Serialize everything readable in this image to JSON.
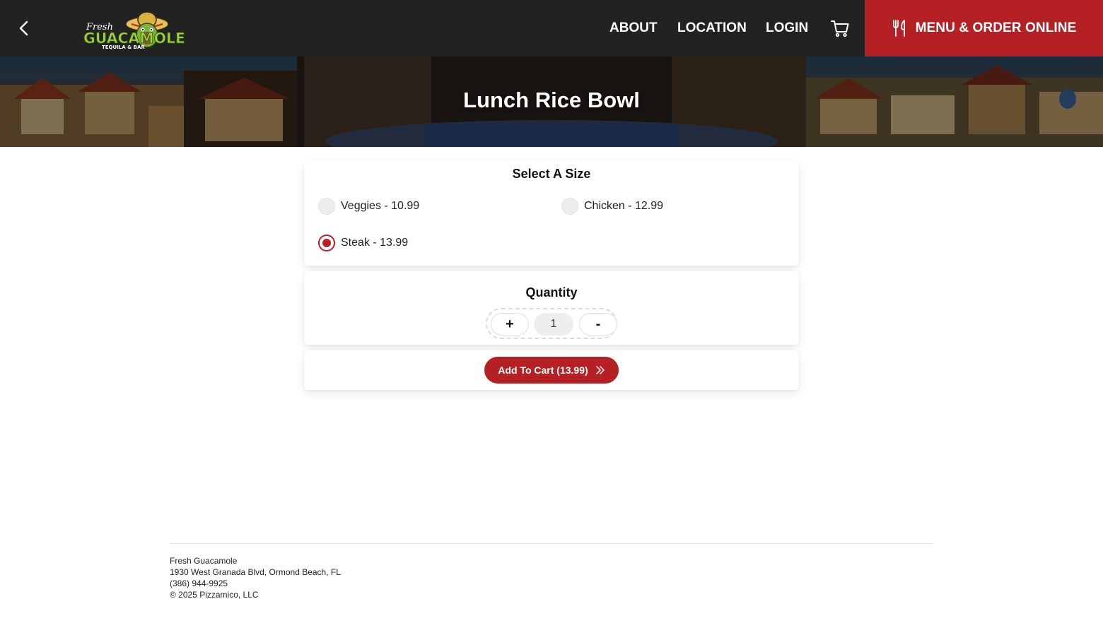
{
  "header": {
    "back_icon": "chevron-left-icon",
    "logo": {
      "line1": "Fresh",
      "line2": "GUACAMOLE",
      "line3": "TEQUILA & BAR"
    },
    "nav": [
      "ABOUT",
      "LOCATION",
      "LOGIN"
    ],
    "cart_icon": "cart-icon",
    "order_button": {
      "icon": "fork-knife-icon",
      "label": "MENU & ORDER ONLINE"
    }
  },
  "hero": {
    "title": "Lunch Rice Bowl"
  },
  "size_section": {
    "title": "Select A Size",
    "options": [
      {
        "label": "Veggies - 10.99",
        "checked": false
      },
      {
        "label": "Chicken - 12.99",
        "checked": false
      },
      {
        "label": "Steak - 13.99",
        "checked": true
      }
    ]
  },
  "quantity_section": {
    "title": "Quantity",
    "plus": "+",
    "value": "1",
    "minus": "-"
  },
  "cart_section": {
    "label": "Add To Cart (13.99)",
    "icon": "double-chevron-right-icon"
  },
  "footer": {
    "name": "Fresh Guacamole",
    "address": "1930 West Granada Blvd, Ormond Beach, FL",
    "phone": "(386) 944-9925",
    "copyright": "© 2025 Pizzamico, LLC"
  },
  "colors": {
    "header_bg": "#222222",
    "accent": "#b52025"
  }
}
